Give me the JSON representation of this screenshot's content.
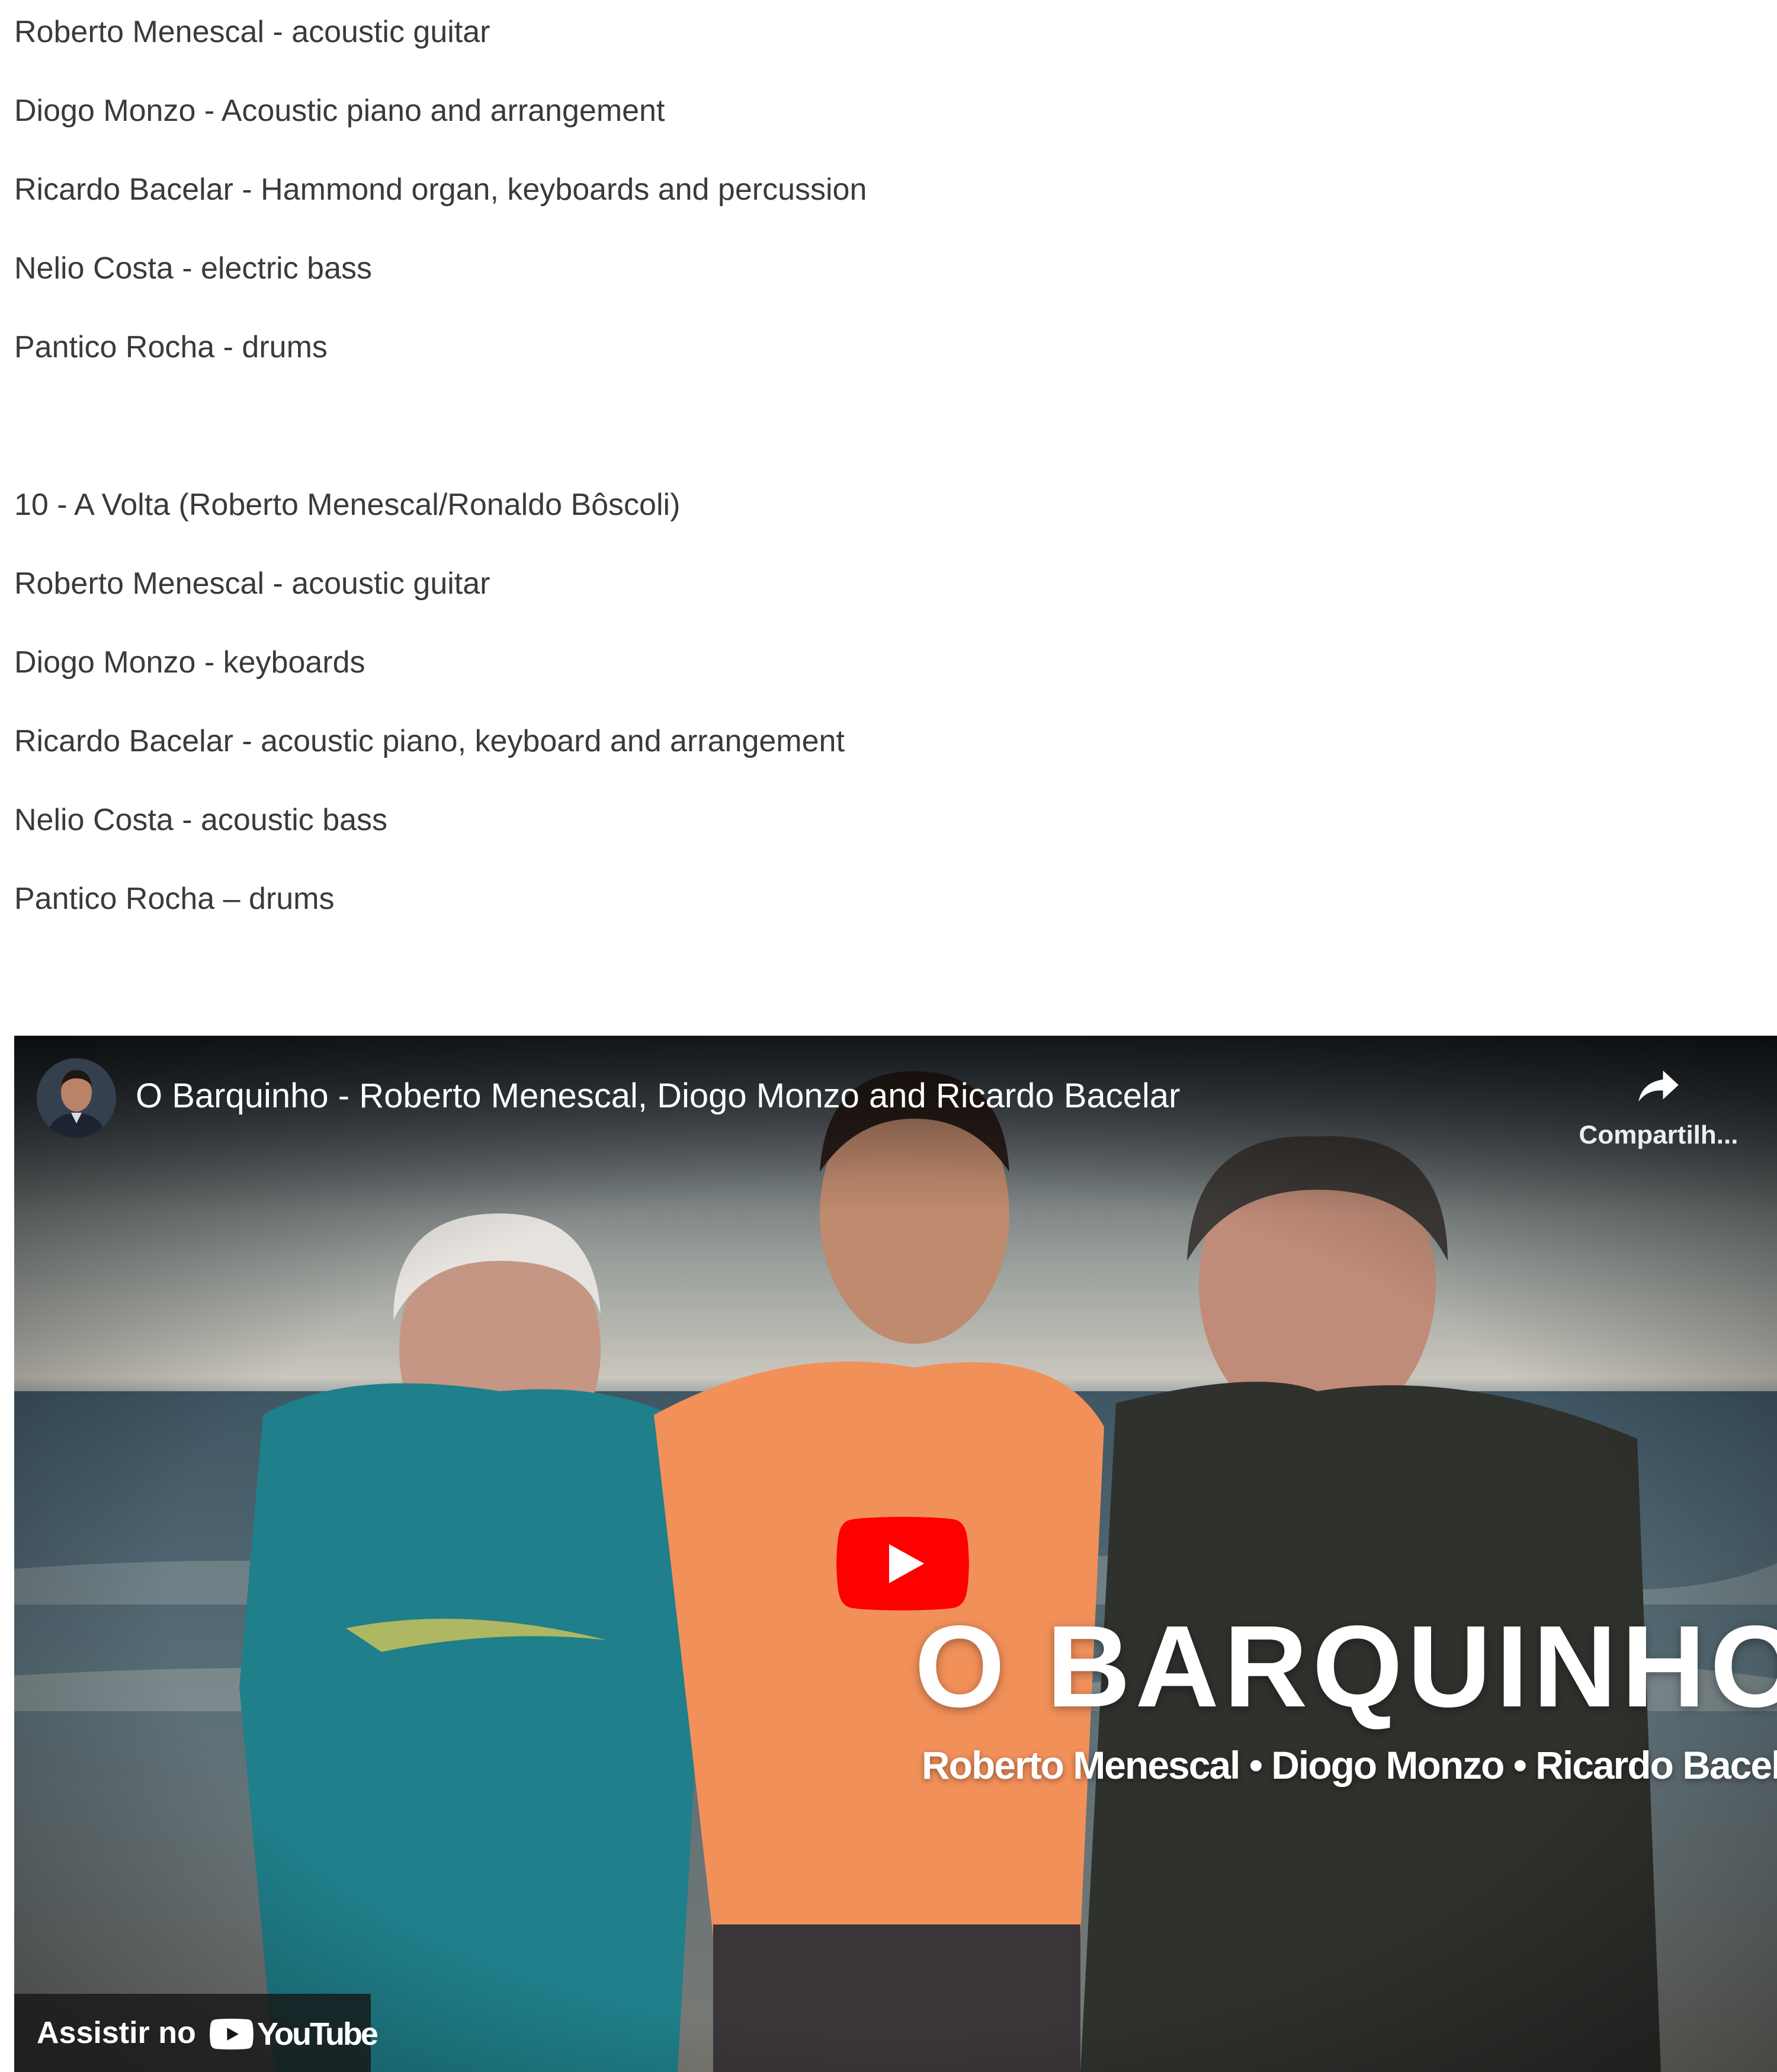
{
  "credits": {
    "lines": [
      "Roberto Menescal - acoustic guitar",
      "Diogo Monzo - Acoustic piano and arrangement",
      "Ricardo Bacelar - Hammond organ, keyboards and percussion",
      "Nelio Costa - electric bass",
      "Pantico Rocha - drums",
      "10 - A Volta (Roberto Menescal/Ronaldo Bôscoli)",
      "Roberto Menescal - acoustic guitar",
      "Diogo Monzo - keyboards",
      "Ricardo Bacelar - acoustic piano, keyboard and arrangement",
      "Nelio Costa - acoustic bass",
      "Pantico Rocha – drums"
    ]
  },
  "video": {
    "title": "O Barquinho - Roberto Menescal, Diogo Monzo and Ricardo Bacelar",
    "share_label": "Compartilh...",
    "overlay_title": "O BARQUINHO",
    "overlay_names": "Roberto Menescal • Diogo Monzo • Ricardo Bacelar",
    "watch_label": "Assistir no",
    "youtube_word": "YouTube",
    "icons": {
      "avatar": "channel-avatar",
      "share": "share-arrow-icon",
      "play": "youtube-play-icon",
      "logo": "youtube-logo-icon"
    },
    "colors": {
      "play_red": "#ff0000",
      "overlay_text": "#ffffff"
    }
  }
}
